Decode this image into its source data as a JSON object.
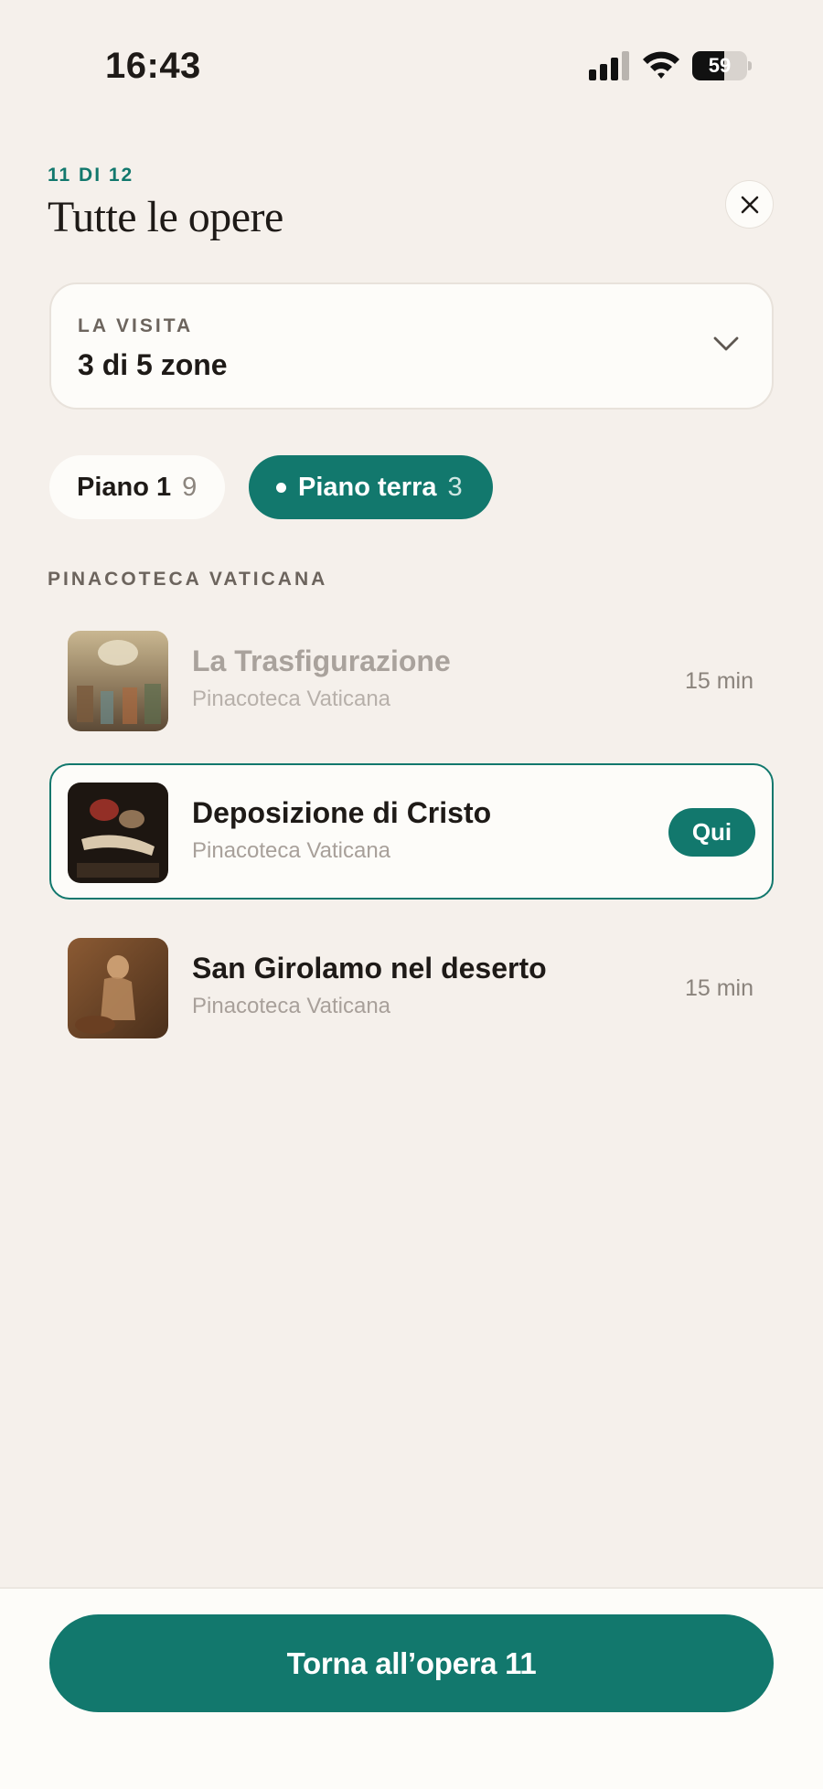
{
  "status_bar": {
    "time": "16:43",
    "battery": "59",
    "battery_level": 0.59
  },
  "header": {
    "counter": "11 DI 12",
    "title": "Tutte le opere"
  },
  "visit": {
    "label": "LA VISITA",
    "value": "3 di 5 zone"
  },
  "floors": [
    {
      "label": "Piano 1",
      "count": "9",
      "selected": false
    },
    {
      "label": "Piano terra",
      "count": "3",
      "selected": true
    }
  ],
  "section": {
    "heading": "PINACOTECA VATICANA",
    "artworks": [
      {
        "title": "La Trasfigurazione",
        "subtitle": "Pinacoteca Vaticana",
        "duration": "15 min",
        "state": "visited"
      },
      {
        "title": "Deposizione di Cristo",
        "subtitle": "Pinacoteca Vaticana",
        "badge": "Qui",
        "state": "current"
      },
      {
        "title": "San Girolamo nel deserto",
        "subtitle": "Pinacoteca Vaticana",
        "duration": "15 min",
        "state": "upcoming"
      }
    ]
  },
  "bottom": {
    "button_label": "Torna all’opera 11"
  },
  "colors": {
    "accent": "#12786d",
    "background": "#f5f0eb",
    "surface": "#fdfcf9"
  }
}
